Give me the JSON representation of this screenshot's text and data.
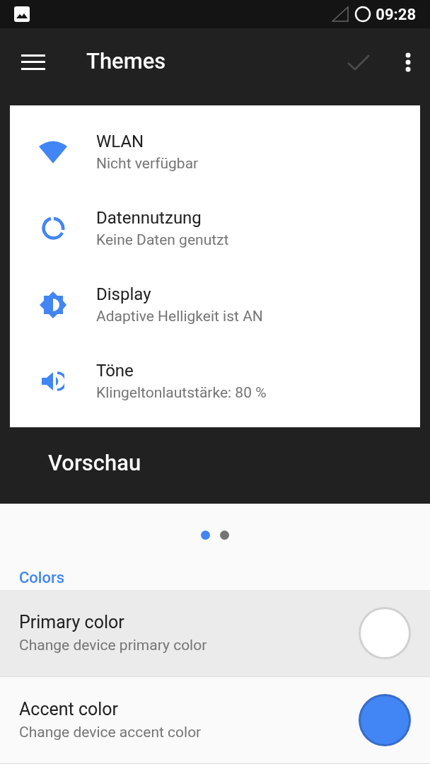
{
  "status_bar": {
    "time": "09:28"
  },
  "toolbar": {
    "title": "Themes",
    "confirm": {
      "disabled": true
    }
  },
  "preview": {
    "items": [
      {
        "kind": "wifi",
        "title": "WLAN",
        "subtitle": "Nicht verfügbar"
      },
      {
        "kind": "data",
        "title": "Datennutzung",
        "subtitle": "Keine Daten genutzt"
      },
      {
        "kind": "brightness",
        "title": "Display",
        "subtitle": "Adaptive Helligkeit ist AN"
      },
      {
        "kind": "volume",
        "title": "Töne",
        "subtitle": "Klingeltonlautstärke: 80 %"
      }
    ],
    "label": "Vorschau"
  },
  "pager": [
    {
      "selected": true
    },
    {
      "selected": false
    }
  ],
  "section": "Colors",
  "color_rows": [
    {
      "title": "Primary color",
      "subtitle": "Change device primary color",
      "color": "#ffffff",
      "selected": true
    },
    {
      "title": "Accent color",
      "subtitle": "Change device accent color",
      "color": "#4285f4",
      "selected": false
    }
  ]
}
